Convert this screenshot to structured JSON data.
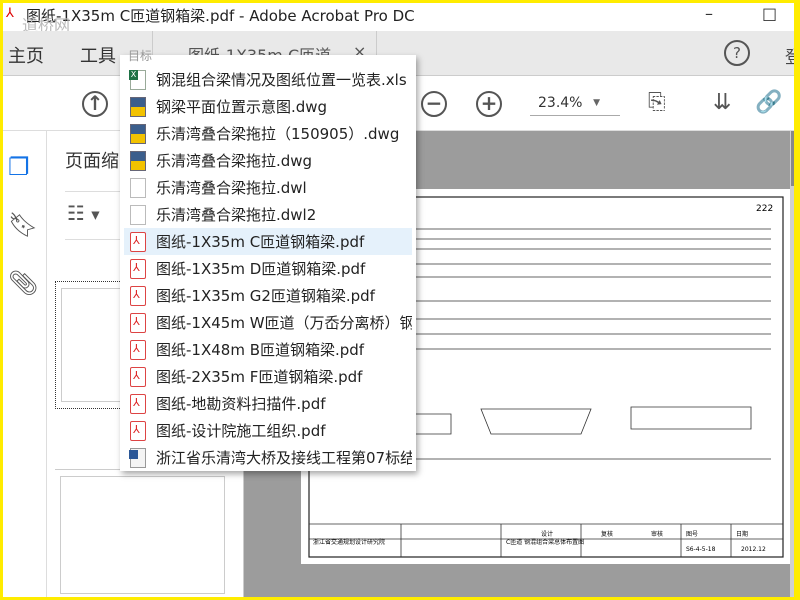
{
  "window": {
    "title": "图纸-1X35m C匝道钢箱梁.pdf - Adobe Acrobat Pro DC",
    "watermark": "道桥网",
    "minimize": "–",
    "maximize": "□"
  },
  "tabs": {
    "home": "主页",
    "tools": "工具",
    "document_tab": "图纸-1X35m C匝道",
    "close": "×",
    "help": "?",
    "login": "登"
  },
  "toolbar": {
    "zoom": "23.4%",
    "zoom_arrow": "▼",
    "up_icon": "↑",
    "zoom_out": "−",
    "zoom_in": "+"
  },
  "panel": {
    "title": "页面缩略图",
    "options_arrow": "▾"
  },
  "dropdown": {
    "header": "目标",
    "selected_index": 6,
    "items": [
      {
        "name": "钢混组合梁情况及图纸位置一览表.xls",
        "type": "xls"
      },
      {
        "name": "钢梁平面位置示意图.dwg",
        "type": "dwg"
      },
      {
        "name": "乐清湾叠合梁拖拉（150905）.dwg",
        "type": "dwg"
      },
      {
        "name": "乐清湾叠合梁拖拉.dwg",
        "type": "dwg"
      },
      {
        "name": "乐清湾叠合梁拖拉.dwl",
        "type": "file"
      },
      {
        "name": "乐清湾叠合梁拖拉.dwl2",
        "type": "file"
      },
      {
        "name": "图纸-1X35m C匝道钢箱梁.pdf",
        "type": "pdf"
      },
      {
        "name": "图纸-1X35m D匝道钢箱梁.pdf",
        "type": "pdf"
      },
      {
        "name": "图纸-1X35m G2匝道钢箱梁.pdf",
        "type": "pdf"
      },
      {
        "name": "图纸-1X45m W匝道（万岙分离桥）钢...",
        "type": "pdf"
      },
      {
        "name": "图纸-1X48m B匝道钢箱梁.pdf",
        "type": "pdf"
      },
      {
        "name": "图纸-2X35m  F匝道钢箱梁.pdf",
        "type": "pdf"
      },
      {
        "name": "图纸-地勘资料扫描件.pdf",
        "type": "pdf"
      },
      {
        "name": "图纸-设计院施工组织.pdf",
        "type": "pdf"
      },
      {
        "name": "浙江省乐清湾大桥及接线工程第07标结...",
        "type": "doc"
      }
    ]
  },
  "drawing": {
    "sheet_no": "222",
    "title_block": "浙江省交通规划设计研究院",
    "drawing_name": "C匝道 钢混组合梁总体布置图",
    "drawing_number": "S6-4-5-18",
    "date": "2012.12",
    "design": "设计",
    "review": "复核",
    "approve": "审核",
    "figno": "图号",
    "datelabel": "日期"
  }
}
